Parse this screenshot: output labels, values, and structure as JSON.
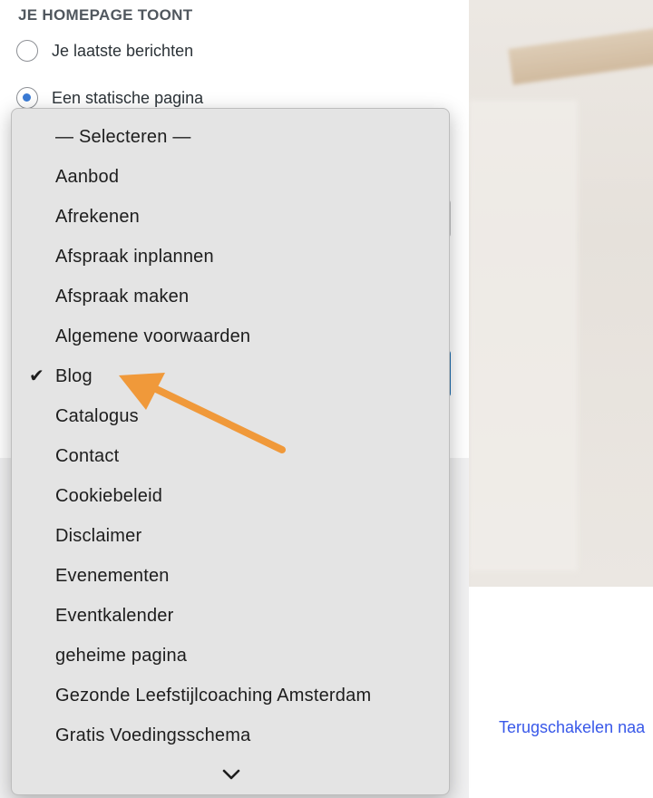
{
  "homepage_settings": {
    "heading": "JE HOMEPAGE TOONT",
    "options": [
      {
        "label": "Je laatste berichten",
        "checked": false
      },
      {
        "label": "Een statische pagina",
        "checked": true
      }
    ]
  },
  "dropdown": {
    "selected": "Blog",
    "items": [
      "— Selecteren —",
      "Aanbod",
      "Afrekenen",
      "Afspraak inplannen",
      "Afspraak maken",
      "Algemene voorwaarden",
      "Blog",
      "Catalogus",
      "Contact",
      "Cookiebeleid",
      "Disclaimer",
      "Evenementen",
      "Eventkalender",
      "geheime pagina",
      "Gezonde Leefstijlcoaching Amsterdam",
      "Gratis Voedingsschema"
    ],
    "checkmark_icon": "checkmark-icon",
    "scroll_icon": "chevron-down-icon"
  },
  "preview": {
    "switch_link": "Terugschakelen naa"
  },
  "annotation": {
    "arrow_color": "#f0993a"
  },
  "colors": {
    "radio_accent": "#3a7bd5",
    "link": "#3858e9",
    "focus_border": "#2271b1"
  }
}
